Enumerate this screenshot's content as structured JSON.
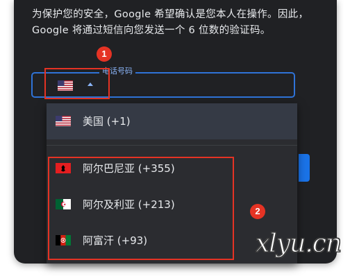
{
  "intro_text": "为保护您的安全，Google 希望确认是您本人在操作。因此，Google 将通过短信向您发送一个 6 位数的验证码。",
  "phone_field": {
    "label": "电话号码",
    "selected_country_flag": "us-flag-icon"
  },
  "annotations": {
    "badge_1": "1",
    "badge_2": "2"
  },
  "dropdown": {
    "selected": {
      "label": "美国 (+1)",
      "flag": "us-flag-icon"
    },
    "options": [
      {
        "label": "阿尔巴尼亚 (+355)",
        "flag": "albania-flag-icon"
      },
      {
        "label": "阿尔及利亚 (+213)",
        "flag": "algeria-flag-icon"
      },
      {
        "label": "阿富汗 (+93)",
        "flag": "afghanistan-flag-icon"
      }
    ]
  },
  "watermark": "xlyu.cn",
  "colors": {
    "panel_bg": "#202124",
    "dropdown_bg": "#2b2c30",
    "selected_bg": "#353a45",
    "accent_blue": "#2f73d8",
    "label_blue": "#8ab4f8",
    "annotation_red": "#e53324",
    "text": "#e8eaed"
  }
}
